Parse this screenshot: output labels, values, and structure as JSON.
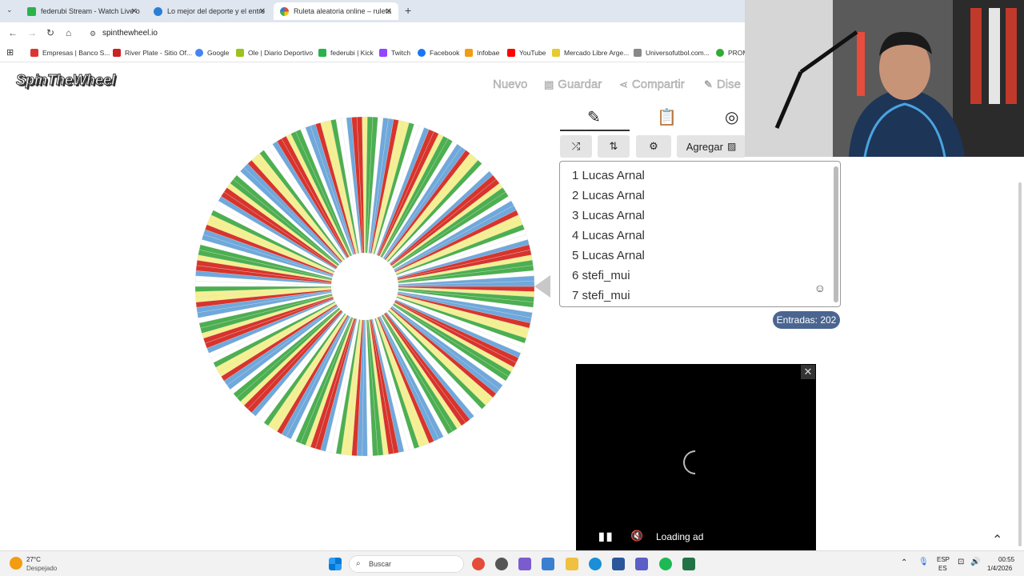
{
  "browser": {
    "tabs": [
      {
        "label": "federubi Stream - Watch Live o",
        "color": "#2bb24c"
      },
      {
        "label": "Lo mejor del deporte y el entre",
        "color": "#2a7fd4"
      },
      {
        "label": "Ruleta aleatoria online – ruleta",
        "color": "#e04a3a"
      }
    ],
    "new_tab": "+",
    "url": "spinthewheel.io",
    "bookmarks": [
      {
        "label": "Empresas | Banco S...",
        "color": "#d33"
      },
      {
        "label": "River Plate - Sitio Of...",
        "color": "#c22"
      },
      {
        "label": "Google",
        "color": "#4285f4"
      },
      {
        "label": "Ole | Diario Deportivo",
        "color": "#9bc31c"
      },
      {
        "label": "federubi | Kick",
        "color": "#2bb24c"
      },
      {
        "label": "Twitch",
        "color": "#9146ff"
      },
      {
        "label": "Facebook",
        "color": "#1877f2"
      },
      {
        "label": "Infobae",
        "color": "#f39c12"
      },
      {
        "label": "YouTube",
        "color": "#ff0000"
      },
      {
        "label": "Mercado Libre Arge...",
        "color": "#e6cb2c"
      },
      {
        "label": "Universofutbol.com...",
        "color": "#888"
      },
      {
        "label": "PROM",
        "color": "#3a3"
      }
    ]
  },
  "app": {
    "logo": "SpinTheWheel",
    "top_actions": [
      "Nuevo",
      "Guardar",
      "Compartir",
      "Dise"
    ],
    "toolbar": {
      "add_label": "Agregar"
    },
    "entries": [
      "1 Lucas Arnal",
      "2 Lucas Arnal",
      "3 Lucas Arnal",
      "4 Lucas Arnal",
      "5 Lucas Arnal",
      "6 stefi_mui",
      "7 stefi_mui"
    ],
    "entries_count": "Entradas: 202",
    "wheel": {
      "segment_count": 202,
      "palette": [
        "#d8342c",
        "#4caf50",
        "#6fa8dc",
        "#f5f090",
        "#ffffff"
      ]
    }
  },
  "ad": {
    "loading_text": "Loading ad",
    "close_label": "✕"
  },
  "taskbar": {
    "weather_temp": "27°C",
    "weather_desc": "Despejado",
    "search_placeholder": "Buscar",
    "lang1": "ESP",
    "lang2": "ES",
    "time": "00:55",
    "date": "1/4/2026"
  }
}
